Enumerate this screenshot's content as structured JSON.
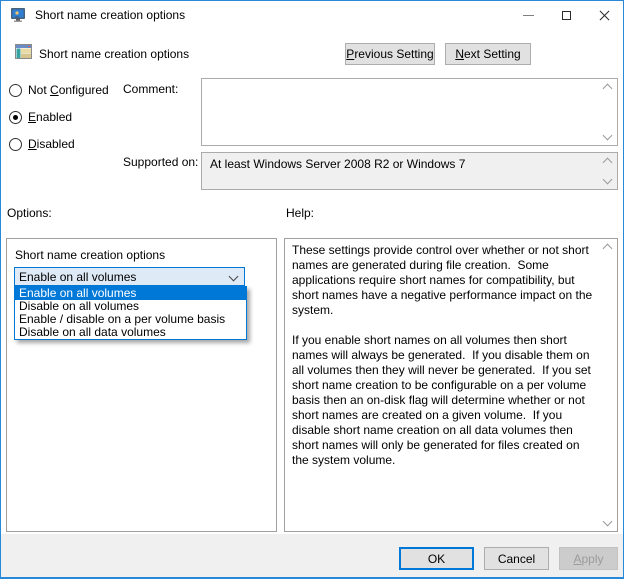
{
  "window": {
    "title": "Short name creation options"
  },
  "header": {
    "title": "Short name creation options",
    "previous_button": {
      "accel": "P",
      "post": "revious Setting"
    },
    "next_button": {
      "accel": "N",
      "post": "ext Setting"
    }
  },
  "config": {
    "radios": [
      {
        "pre": "Not ",
        "accel": "C",
        "post": "onfigured",
        "selected": false
      },
      {
        "pre": "",
        "accel": "E",
        "post": "nabled",
        "selected": true
      },
      {
        "pre": "",
        "accel": "D",
        "post": "isabled",
        "selected": false
      }
    ],
    "comment_label": "Comment:",
    "comment_value": "",
    "supported_label": "Supported on:",
    "supported_value": "At least Windows Server 2008 R2 or Windows 7"
  },
  "options": {
    "label": "Options:",
    "setting_label": "Short name creation options",
    "dropdown": {
      "selected": "Enable on all volumes",
      "highlighted_index": 0,
      "items": [
        "Enable on all volumes",
        "Disable on all volumes",
        "Enable / disable on a per volume basis",
        "Disable on all data volumes"
      ]
    }
  },
  "help": {
    "label": "Help:",
    "text": "These settings provide control over whether or not short names are generated during file creation.  Some applications require short names for compatibility, but short names have a negative performance impact on the system.\n\nIf you enable short names on all volumes then short names will always be generated.  If you disable them on all volumes then they will never be generated.  If you set short name creation to be configurable on a per volume basis then an on-disk flag will determine whether or not short names are created on a given volume.  If you disable short name creation on all data volumes then short names will only be generated for files created on the system volume."
  },
  "footer": {
    "ok_label": "OK",
    "cancel_label": "Cancel",
    "apply_button": {
      "accel": "A",
      "post": "pply"
    }
  },
  "icons": {
    "titlebar": "group-policy-app-icon",
    "header": "policy-setting-icon",
    "combobox": "chevron-down-icon",
    "scrollbars": "scroll-up-icon / scroll-down-icon"
  },
  "colors": {
    "accent": "#0078d7",
    "window_border": "#2989d8",
    "selection_bg": "#0078d7",
    "selection_text": "#ffffff",
    "button_bg": "#e1e1e1",
    "button_border": "#adadad",
    "combo_bg": "#dfeaf7",
    "footer_bg": "#f0f0f0",
    "supported_bg": "#f0f0f0",
    "disabled_text": "#9b9b9b"
  }
}
